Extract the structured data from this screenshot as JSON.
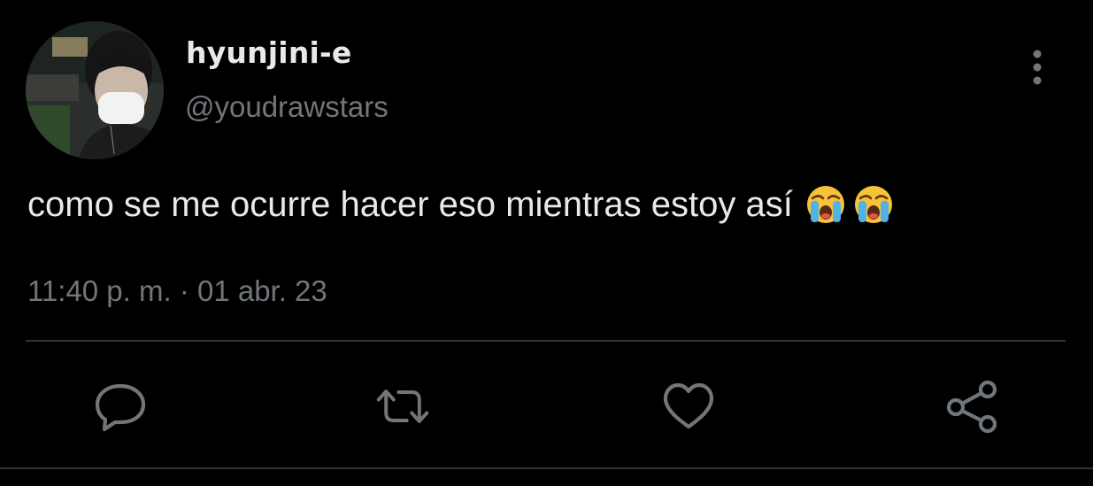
{
  "tweet": {
    "display_name": "hyunjini-e",
    "handle": "@youdrawstars",
    "text": "como se me ocurre hacer eso mientras estoy así",
    "emojis": [
      "loudly-crying-face",
      "loudly-crying-face"
    ],
    "timestamp": "11:40 p. m. · 01 abr. 23"
  },
  "icons": {
    "more": "more-vertical-icon",
    "reply": "reply-icon",
    "retweet": "retweet-icon",
    "like": "heart-icon",
    "share": "share-icon"
  },
  "colors": {
    "background": "#000000",
    "primary_text": "#e7e9ea",
    "secondary_text": "#71767b",
    "divider": "#2f3336"
  }
}
